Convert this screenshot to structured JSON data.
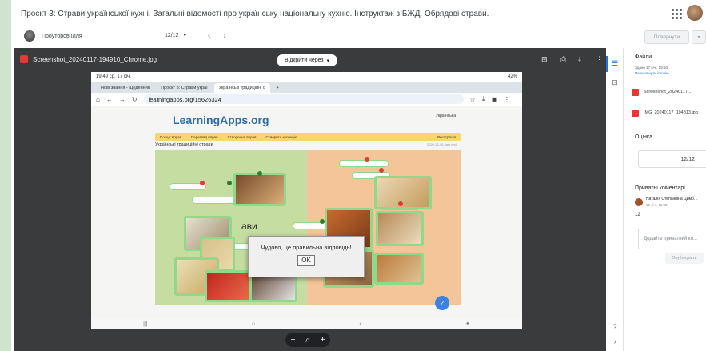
{
  "header": {
    "title": "Проєкт 3: Страви української кухні. Загальні відомості про українську національну кухню. Інструктаж з БЖД. Обрядові страви."
  },
  "subbar": {
    "student_name": "Проуторов Ілля",
    "grade_display": "12/12",
    "dropdown_glyph": "▾",
    "prev_glyph": "‹",
    "next_glyph": "›",
    "return_label": "Повернути",
    "return_drop_glyph": "▾"
  },
  "viewer": {
    "filename": "Screenshot_20240117-194910_Chrome.jpg",
    "open_with_label": "Відкрити через",
    "zoom_minus": "−",
    "zoom_plus": "+"
  },
  "phone": {
    "status_time": "19:49 ср, 17 січ.",
    "status_battery": "42%",
    "tabs": [
      "Нові знання - Щоденник",
      "Проєкт 3: Страви украї",
      "Українські традиційні с"
    ],
    "new_tab_glyph": "+",
    "url": "learningapps.org/15626324",
    "la_logo": "LearningApps.org",
    "la_lang": "Українська",
    "la_menu": [
      "Перегляд вправ",
      "Створення вправ",
      "Створити колекцію",
      "Реєстрація"
    ],
    "la_search_placeholder": "Пошук вправ",
    "exercise_title": "Українські традиційні страви",
    "exercise_date": "2020-12-06 (last mn)",
    "game_word": "ави",
    "dialog_message": "Чудово, це правильна відповідь!",
    "ok_label": "OK"
  },
  "sidepanel": {
    "files_title": "Файли",
    "files_meta": "Здано 17 січ., 19:50",
    "files_link": "Переглянути історію",
    "files": [
      "Screenshot_20240117...",
      "IMG_20240117_194813.jpg"
    ],
    "grade_title": "Оцінка",
    "grade_value": "12/12",
    "comments_title": "Приватні коментарі",
    "commenter": "Наталія Степанівна Цимб…",
    "comment_time": "19 січ., 11:03",
    "comment_text": "12",
    "comment_placeholder": "Додайте приватний ко...",
    "post_label": "Опублікувати"
  },
  "colors": {
    "card_border": "#8fd98a",
    "accent": "#1a73e8"
  }
}
